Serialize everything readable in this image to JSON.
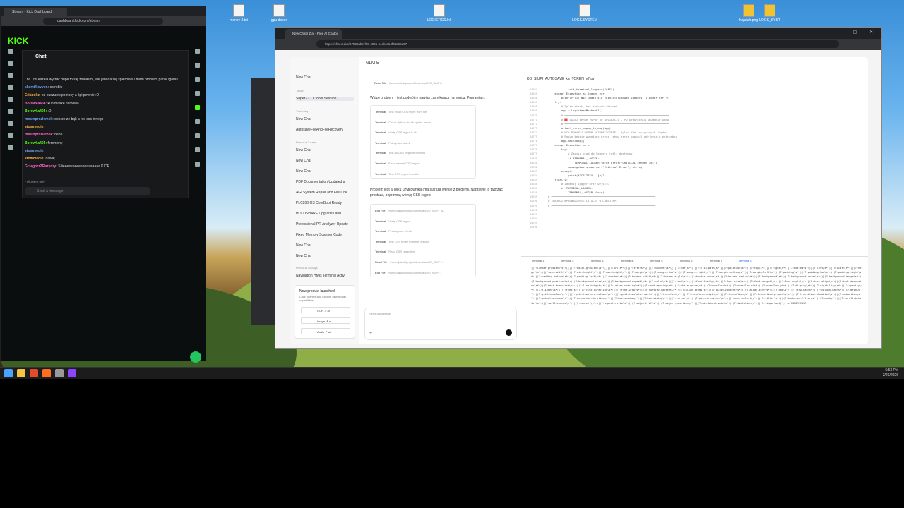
{
  "desktop": {
    "icons": [
      "money 2.txt",
      "gpu doser",
      "LOGISTICS.lnk",
      "LOGS.SYSTEM",
      "hajutuh.png",
      "LOGS_SYST"
    ]
  },
  "kick": {
    "tab_title": "Stream - Kick Dashboard",
    "url": "dashboard.kick.com/stream",
    "logo": "KICK",
    "chat_title": "Chat",
    "chat_messages": [
      {
        "user": "",
        "text": ". no i mi kazała wyłżać dupe to się żrobiłam , ale jebana się spierdlala i mam problem panie Igoras"
      },
      {
        "user": "skemi4levven:",
        "text": " co robic"
      },
      {
        "user": "Eriabollz:",
        "text": " bo buszujec po nocy a śpi pewnie :D"
      },
      {
        "user": "Borowka404:",
        "text": " kup maske flamowa"
      },
      {
        "user": "Borowka404:",
        "text": " :D"
      },
      {
        "user": "mesinprozlemek:",
        "text": " dobrze ze bąk a nie cos innego"
      },
      {
        "user": "stommedie:",
        "text": ""
      },
      {
        "user": "mesinprozlemek:",
        "text": " hehe"
      },
      {
        "user": "Borowka404:",
        "text": " feromony"
      },
      {
        "user": "stommedie:",
        "text": ""
      },
      {
        "user": "stommedie:",
        "text": " dawaj"
      },
      {
        "user": "Grzegorz2Flarydry:",
        "text": " Siiieeeeeeeeeeeeaaaaaaa KIOR"
      }
    ],
    "followers_only": "Followers only",
    "message_placeholder": "Send a message",
    "user_colors": [
      "#53fc18",
      "#6ea8ff",
      "#ffb347",
      "#ff66cc"
    ]
  },
  "zai": {
    "tab_title": "New Chat | Z.ai - Free AI Chatbo",
    "url": "https://chat.z.ai/c/b7560abe-f65-4091-a1eb-d14f33a65d67",
    "new_chat": "New Chat",
    "model": "GLM-5",
    "sidebar": {
      "today": "Today",
      "items_today": [
        "Super2 CLI Tools Session"
      ],
      "yesterday": "Yesterday",
      "items_yesterday": [
        "New Chat",
        "AutosaveFileAndFileRecovery"
      ],
      "prev7": "Previous 7 days",
      "items_prev7": [
        "New Chat",
        "New Chat",
        "New Chat",
        "PDF Documentation Updated a",
        "AGI System Repair and File Link",
        "PLC200 OS CoreBoot Ready",
        "HOLDSHARE Upgrades and",
        "Professional PR Analyzer Update",
        "Fixed Memory Scanner Code",
        "New Chat",
        "New Chat"
      ],
      "prev30": "Previous 30 days",
      "items_prev30": [
        "Navigation HMIs Terminal Activ"
      ]
    },
    "promo": {
      "title": "New product launched",
      "desc": "Click to enter and explore new model capabilities",
      "buttons": [
        "OCR ↗ ai",
        "Image ↗ ai",
        "Audio ↗ ai"
      ]
    },
    "messages": {
      "read_file_top": "Read File",
      "read_file_top_path": "/home/jakub/project/download/KO_SIUPI...",
      "para1": "Widzę problem - jest podwójny nawias zamykający na końcu. Poprawiam:",
      "card1": [
        {
          "k": "Terminal",
          "v": "Test exact CSS regex from file"
        },
        {
          "k": "Terminal",
          "v": "Check Python for lib syntax errors"
        },
        {
          "k": "Terminal",
          "v": "Verify CSS regex is ok"
        },
        {
          "k": "Terminal",
          "v": "Full syntax check"
        },
        {
          "k": "Terminal",
          "v": "Test all CSS regex definitions"
        },
        {
          "k": "Terminal",
          "v": "Fixed named CSS regex"
        },
        {
          "k": "Terminal",
          "v": "Test CSS regex from file"
        }
      ],
      "para2": "Problem jest w pliku użytkownika (ma starszą wersję z błędem). Naprawię to tworząc prostszą, poprawną wersję CSS regex:",
      "card2": [
        {
          "k": "Edit File",
          "v": "/home/jakub/project/download/KO_SIUPI_A..."
        },
        {
          "k": "Terminal",
          "v": "Verify CSS regex"
        },
        {
          "k": "Terminal",
          "v": "Final syntax check"
        },
        {
          "k": "Terminal",
          "v": "Test CSS regex from file directly"
        },
        {
          "k": "Terminal",
          "v": "Read CSS regex line"
        },
        {
          "k": "Read File",
          "v": "/home/jakub/project/download/KO_SIUPI..."
        },
        {
          "k": "Edit File",
          "v": "/home/jakub/project/download/KO_SIUPI..."
        }
      ],
      "composer_placeholder": "Send a Message"
    },
    "code": {
      "filename": "KO_SIUPI_AUTOSAVE_kg_TOREN_v7.py",
      "line_numbers": [
        "44764",
        "44765",
        "44766",
        "44767",
        "44768",
        "44769",
        "44770",
        "44771",
        "44772",
        "44773",
        "44774",
        "44775",
        "44776",
        "44777",
        "44778",
        "44779",
        "44780",
        "44781",
        "44782",
        "44783",
        "44784",
        "44785",
        "44786",
        "44787",
        "44788",
        "44789",
        "44790",
        "44791",
        "44792",
        "44793",
        "44794",
        "44795",
        "44796",
        "44797",
        "44798",
        "44799"
      ],
      "lines": [
        "            init_terminal_loggers(\"CAS\")",
        "    except Exception as logger_err:",
        "        print(f\"[⚠] Nie udało się zainicjalizować loggers: {logger_err}\")",
        "",
        "    try:",
        "        # Tylko start, bez żadnych okienek",
        "        app = LogisternMcAbout1()",
        "",
        "        # ═══════════════════════════════════════════════════════════════",
        "        # 🟥 DODAJ ERROR POPUP DO APLIKACJI - PO UTWORZENIU GŁÓWNEGO OKNA",
        "        # ═══════════════════════════════════════════════════════════════",
        "        attach_error_popup_to_app(app)",
        "",
        "        # NIE POKAZUJ POPUP AUTOMATYCZNIE - tylko dla krytycznych błędów",
        "        # Popup będzie wywołany przez _show_error_popup() gdy będzie potrzebny",
        "",
        "        app.mainloop()",
        "    except Exception as e:",
        "        try:",
        "            # Zapisz błąd do loggera jeśli dostępny",
        "            if TERMINAL_LOGGER:",
        "                TERMINAL_LOGGER.force_error(\"CRITICAL ERROR: {e}\")",
        "            messagebox.showerror(\"Critical Error\", str(e))",
        "        except:",
        "            print(f\"CRITICAL: {e}\")",
        "    finally:",
        "        # Zamknij logger przy wyjściu",
        "        if TERMINAL_LOGGER:",
        "            TERMINAL_LOGGER.close()",
        "",
        "# ═══════════════════════════════════════════════════════════════",
        "# ZAKAŃCZ WPROWADZENIE LITACJI W CAŁEJ API",
        "# ═══════════════════════════════════════════════════════════════"
      ],
      "terminals": [
        "Terminal 1",
        "Terminal 2",
        "Terminal 3",
        "Terminal 4",
        "Terminal 5",
        "Terminal 6",
        "Terminal 7",
        "Terminal 8"
      ],
      "terminal_text": "|(?:linear-gradient\\s*\\()|(?:radial-gradient\\s*\\()|(?:url\\s*\\()|(?:attr\\s*\\()|(?:counter\\s*\\()|(?:var\\s*\\()|(?:clip-path\\s*:)|(?:position\\s*:)|(?:top\\s*:)|(?:right\\s*:)|(?:bottom\\s*:)|(?:left\\s*:)|(?:width\\s*:)|(?:height\\s*:)|(?:min-width\\s*:)|(?:min-height\\s*:)|(?:max-height\\s*:)|(?:margin\\s*:)|(?:margin-top\\s*:)|(?:margin-right\\s*:)|(?:margin-bottom\\s*:)|(?:margin-left\\s*:)|(?:padding\\s*:)|(?:padding-top\\s*:)|(?:padding-right\\s*:)|(?:padding-bottom\\s*:)|(?:padding-left\\s*:)|(?:border\\s*:)|(?:border-width\\s*:)|(?:border-style\\s*:)|(?:border-color\\s*:)|(?:border-radius\\s*:)|(?:background\\s*:)|(?:background-color\\s*:)|(?:background-image\\s*:)|(?:background-position\\s*:)|(?:background-size\\s*:)|(?:background-repeat\\s*:)|(?:color\\s*:)|(?:font\\s*:)|(?:font-family\\s*:)|(?:font-size\\s*:)|(?:font-weight\\s*:)|(?:font-style\\s*:)|(?:text-align\\s*:)|(?:text-decoration\\s*:)|(?:text-transform\\s*:)|(?:line-height\\s*:)|(?:letter-spacing\\s*:)|(?:word-spacing\\s*:)|(?:white-space\\s*:)|(?:overflow\\s*:)|(?:overflow-x\\s*:)|(?:overflow-y\\s*:)|(?:display\\s*:)|(?:visibility\\s*:)|(?:opacity\\s*:)|(?:z-index\\s*:)|(?:flex\\s*:)|(?:flex-direction\\s*:)|(?:flex-wrap\\s*:)|(?:justify-content\\s*:)|(?:align-items\\s*:)|(?:align-content\\s*:)|(?:align-self\\s*:)|(?:gap\\s*:)|(?:row-gap\\s*:)|(?:column-gap\\s*:)|(?:grid\\s*:)|(?:grid-template\\s*:)|(?:grid-template-columns\\s*:)|(?:grid-template-rows\\s*:)|(?:transform\\s*:)|(?:transform-origin\\s*:)|(?:transition\\s*:)|(?:transition-property\\s*:)|(?:transition-duration\\s*:)|(?:animation\\s*:)|(?:animation-name\\s*:)|(?:animation-duration\\s*:)|(?:box-shadow\\s*:)|(?:box-sizing\\s*:)|(?:cursor\\s*:)|(?:pointer-events\\s*:)|(?:user-select\\s*:)|(?:filter\\s*:)|(?:backdrop-filter\\s*:)|(?:mask\\s*:)|(?:scroll-behavior\\s*:)|(?:will-change\\s*:)|(?:content\\s*:)|(?:aspect-ratio\\s*:)|(?:object-fit\\s*:)|(?:object-position\\s*:)|(?:mix-blend-mode\\s*:)|(?:isolation\\s*:)|(?:!important)\", re.IGNORECASE)"
    }
  },
  "taskbar": {
    "time": "6:53 PM",
    "date": "2/26/2026"
  }
}
